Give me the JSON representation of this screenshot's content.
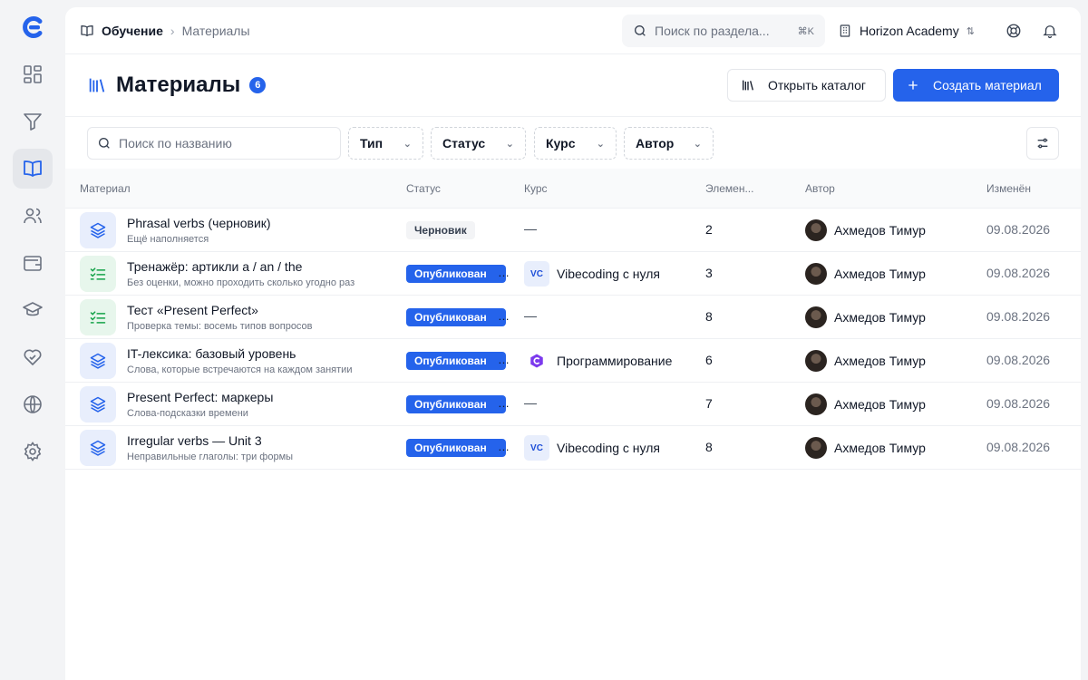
{
  "rail": {
    "items": [
      {
        "name": "dashboard-icon"
      },
      {
        "name": "funnel-icon"
      },
      {
        "name": "book-icon",
        "active": true
      },
      {
        "name": "users-icon"
      },
      {
        "name": "wallet-icon"
      },
      {
        "name": "graduation-cap-icon"
      },
      {
        "name": "heart-handshake-icon"
      },
      {
        "name": "globe-icon"
      },
      {
        "name": "gear-icon"
      }
    ]
  },
  "breadcrumb": {
    "root": "Обучение",
    "current": "Материалы"
  },
  "search": {
    "placeholder": "Поиск по раздела...",
    "shortcut": "⌘K"
  },
  "org": {
    "name": "Horizon Academy"
  },
  "page": {
    "title": "Материалы",
    "count": "6"
  },
  "actions": {
    "catalog_label": "Открыть каталог",
    "create_label": "Создать материал"
  },
  "filters": {
    "search_placeholder": "Поиск по названию",
    "type_label": "Тип",
    "status_label": "Статус",
    "course_label": "Курс",
    "author_label": "Автор"
  },
  "table": {
    "columns": {
      "material": "Материал",
      "status": "Статус",
      "course": "Курс",
      "elements": "Элемен...",
      "author": "Автор",
      "modified": "Изменён"
    },
    "rows": [
      {
        "title": "Phrasal verbs (черновик)",
        "subtitle": "Ещё наполняется",
        "icon": "layers-icon",
        "icon_color": "blue",
        "status": "Черновик",
        "status_kind": "draft",
        "course": "—",
        "course_icon": "",
        "elements": "2",
        "author": "Ахмедов Тимур",
        "modified": "09.08.2026"
      },
      {
        "title": "Тренажёр: артикли a / an / the",
        "subtitle": "Без оценки, можно проходить сколько угодно раз",
        "icon": "checklist-icon",
        "icon_color": "green",
        "status": "Опубликован",
        "status_kind": "pub",
        "course": "Vibecoding с нуля",
        "course_icon": "VC",
        "elements": "3",
        "author": "Ахмедов Тимур",
        "modified": "09.08.2026"
      },
      {
        "title": "Тест «Present Perfect»",
        "subtitle": "Проверка темы: восемь типов вопросов",
        "icon": "checklist-icon",
        "icon_color": "green",
        "status": "Опубликован",
        "status_kind": "pub",
        "course": "—",
        "course_icon": "",
        "elements": "8",
        "author": "Ахмедов Тимур",
        "modified": "09.08.2026"
      },
      {
        "title": "IT-лексика: базовый уровень",
        "subtitle": "Слова, которые встречаются на каждом занятии",
        "icon": "layers-icon",
        "icon_color": "blue",
        "status": "Опубликован",
        "status_kind": "pub",
        "course": "Программирование",
        "course_icon": "csharp",
        "elements": "6",
        "author": "Ахмедов Тимур",
        "modified": "09.08.2026"
      },
      {
        "title": "Present Perfect: маркеры",
        "subtitle": "Слова-подсказки времени",
        "icon": "layers-icon",
        "icon_color": "blue",
        "status": "Опубликован",
        "status_kind": "pub",
        "course": "—",
        "course_icon": "",
        "elements": "7",
        "author": "Ахмедов Тимур",
        "modified": "09.08.2026"
      },
      {
        "title": "Irregular verbs — Unit 3",
        "subtitle": "Неправильные глаголы: три формы",
        "icon": "layers-icon",
        "icon_color": "blue",
        "status": "Опубликован",
        "status_kind": "pub",
        "course": "Vibecoding с нуля",
        "course_icon": "VC",
        "elements": "8",
        "author": "Ахмедов Тимур",
        "modified": "09.08.2026"
      }
    ]
  },
  "colors": {
    "accent": "#2563eb",
    "draft_bg": "#f3f4f6"
  }
}
